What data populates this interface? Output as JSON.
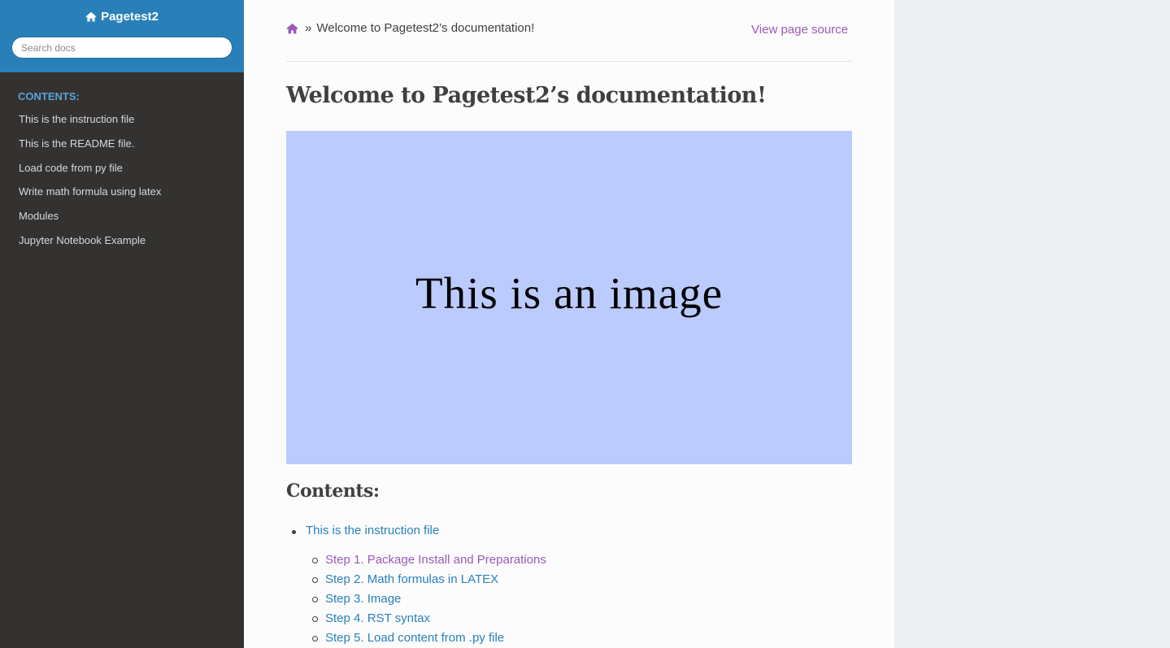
{
  "sidebar": {
    "project_name": "Pagetest2",
    "search_placeholder": "Search docs",
    "caption": "CONTENTS:",
    "items": [
      {
        "label": "This is the instruction file"
      },
      {
        "label": "This is the README file."
      },
      {
        "label": "Load code from py file"
      },
      {
        "label": "Write math formula using latex"
      },
      {
        "label": "Modules"
      },
      {
        "label": "Jupyter Notebook Example"
      }
    ]
  },
  "breadcrumbs": {
    "separator": "»",
    "current": "Welcome to Pagetest2’s documentation!",
    "view_source": "View page source"
  },
  "page": {
    "title": "Welcome to Pagetest2’s documentation!",
    "image_text": "This is an image",
    "contents_heading": "Contents:",
    "toc": [
      {
        "label": "This is the instruction file",
        "children": [
          {
            "label": "Step 1. Package Install and Preparations",
            "visited": true
          },
          {
            "label": "Step 2. Math formulas in LATEX",
            "visited": false
          },
          {
            "label": "Step 3. Image",
            "visited": false
          },
          {
            "label": "Step 4. RST syntax",
            "visited": false
          },
          {
            "label": "Step 5. Load content from .py file",
            "visited": false
          }
        ]
      }
    ]
  },
  "icons": {
    "project_icon": "home-icon",
    "breadcrumb_icon": "home-icon"
  },
  "colors": {
    "brand": "#2980b9",
    "link": "#2980b9",
    "visited_link": "#9b59b6",
    "caption": "#55a5d9",
    "sidebar_bg": "#343131",
    "image_bg": "#bccbfe"
  }
}
